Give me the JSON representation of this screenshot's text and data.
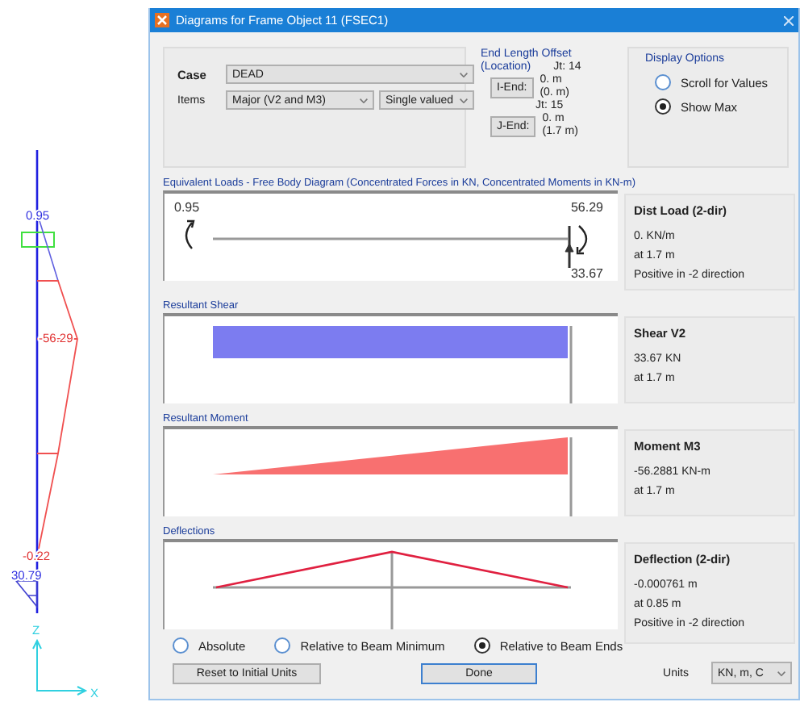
{
  "structure_view": {
    "labels": [
      {
        "kind": "shear",
        "text": "0.95"
      },
      {
        "kind": "moment",
        "text": "-56.29"
      },
      {
        "kind": "moment",
        "text": "-0.22"
      },
      {
        "kind": "shear",
        "text": "30.79"
      }
    ],
    "axis_labels": [
      "Z",
      "X"
    ]
  },
  "window": {
    "title": "Diagrams for Frame Object 11  (FSEC1)"
  },
  "case": {
    "label": "Case",
    "value": "DEAD"
  },
  "items": {
    "label": "Items",
    "values": [
      "Major (V2 and M3)",
      "Single valued"
    ]
  },
  "end_offset": {
    "title": "End Length Offset",
    "subtitle": "(Location)",
    "ends": [
      {
        "joint": "Jt: 14",
        "button": "I-End:",
        "lines": [
          "0. m",
          "(0. m)"
        ]
      },
      {
        "joint": "Jt: 15",
        "button": "J-End:",
        "lines": [
          "0. m",
          "(1.7 m)"
        ]
      }
    ]
  },
  "display_options": {
    "title": "Display Options",
    "options": [
      {
        "label": "Scroll for Values",
        "selected": false
      },
      {
        "label": "Show Max",
        "selected": true
      }
    ]
  },
  "sections": [
    {
      "kind": "loads",
      "title": "Equivalent Loads - Free Body Diagram  (Concentrated Forces in KN, Concentrated Moments in KN-m)",
      "diagram_labels": [
        "0.95",
        "56.29",
        "33.67"
      ],
      "info_title": "Dist Load (2-dir)",
      "info_lines": [
        "0. KN/m",
        "at 1.7 m",
        "Positive in -2 direction"
      ]
    },
    {
      "kind": "shear",
      "title": "Resultant Shear",
      "info_title": "Shear V2",
      "info_lines": [
        "33.67 KN",
        "at 1.7 m"
      ]
    },
    {
      "kind": "moment",
      "title": "Resultant Moment",
      "info_title": "Moment M3",
      "info_lines": [
        "-56.2881 KN-m",
        "at 1.7 m"
      ]
    },
    {
      "kind": "deflection",
      "title": "Deflections",
      "info_title": "Deflection (2-dir)",
      "info_lines": [
        "-0.000761 m",
        "at 0.85 m",
        "Positive in -2 direction"
      ]
    }
  ],
  "deflection_modes": [
    {
      "label": "Absolute",
      "selected": false
    },
    {
      "label": "Relative to Beam Minimum",
      "selected": false
    },
    {
      "label": "Relative to Beam Ends",
      "selected": true
    }
  ],
  "buttons": {
    "reset": "Reset to Initial Units",
    "done": "Done"
  },
  "units": {
    "label": "Units",
    "value": "KN, m, C"
  }
}
